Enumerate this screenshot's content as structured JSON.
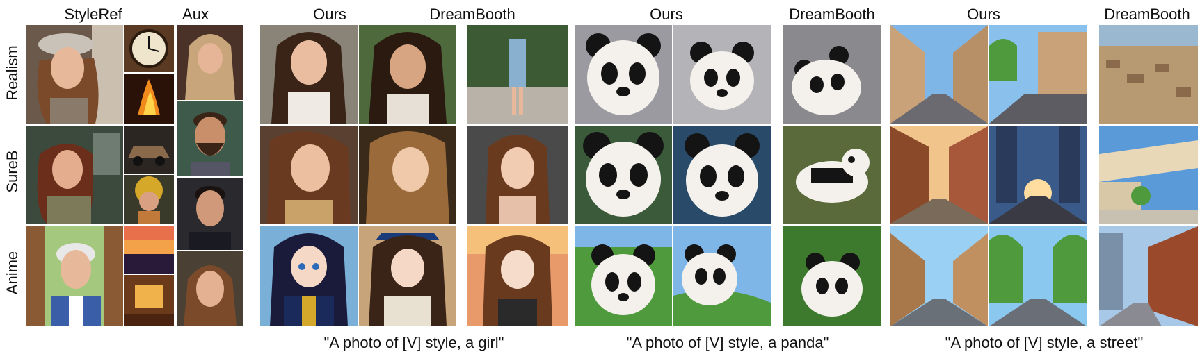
{
  "headers": {
    "styleref": "StyleRef",
    "aux": "Aux",
    "ours_girl": "Ours",
    "dreambooth_girl": "DreamBooth",
    "ours_panda": "Ours",
    "dreambooth_panda": "DreamBooth",
    "ours_street": "Ours",
    "dreambooth_street": "DreamBooth"
  },
  "rows": {
    "realism": "Realism",
    "sureb": "SureB",
    "anime": "Anime"
  },
  "captions": {
    "girl": "\"A photo of [V] style, a girl\"",
    "panda": "\"A photo of [V] style, a panda\"",
    "street": "\"A photo of [V] style, a street\""
  },
  "palette": {
    "skin": "#e8b89a",
    "hair_dark": "#3a2418",
    "hair_brown": "#7a4a2a",
    "panda_white": "#f4f1ec",
    "panda_black": "#141414",
    "sky": "#7fb6e8",
    "building": "#c9a27a",
    "grass": "#4f9a3c"
  }
}
